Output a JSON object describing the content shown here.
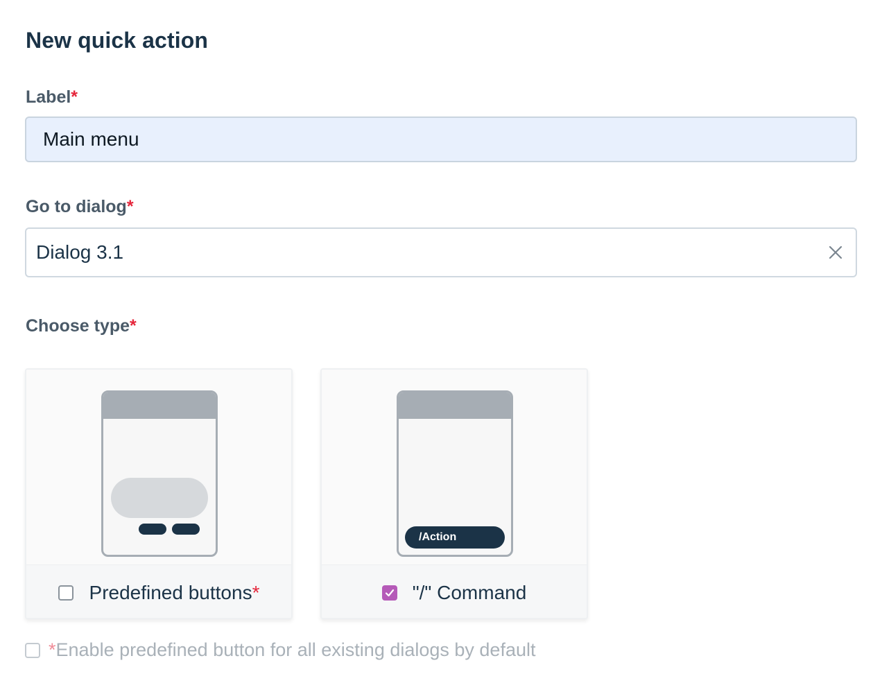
{
  "form": {
    "title": "New quick action",
    "label_field": {
      "label": "Label",
      "required_mark": "*",
      "value": "Main menu"
    },
    "dialog_field": {
      "label": "Go to dialog",
      "required_mark": "*",
      "value": "Dialog 3.1"
    },
    "type_field": {
      "label": "Choose type",
      "required_mark": "*"
    },
    "types": [
      {
        "label": "Predefined buttons",
        "required_mark": "*",
        "checked": false
      },
      {
        "label": "\"/\" Command",
        "preview_text": "/Action",
        "checked": true
      }
    ],
    "enable_default": {
      "required_mark": "*",
      "label": "Enable predefined button for all existing dialogs by default",
      "checked": false,
      "disabled": true
    }
  },
  "colors": {
    "heading": "#1b3347",
    "required": "#e5263b",
    "checkbox_checked": "#b55ab8",
    "input_bg": "#e8f0fd"
  },
  "icons": [
    "clear-icon",
    "checkmark-icon"
  ]
}
